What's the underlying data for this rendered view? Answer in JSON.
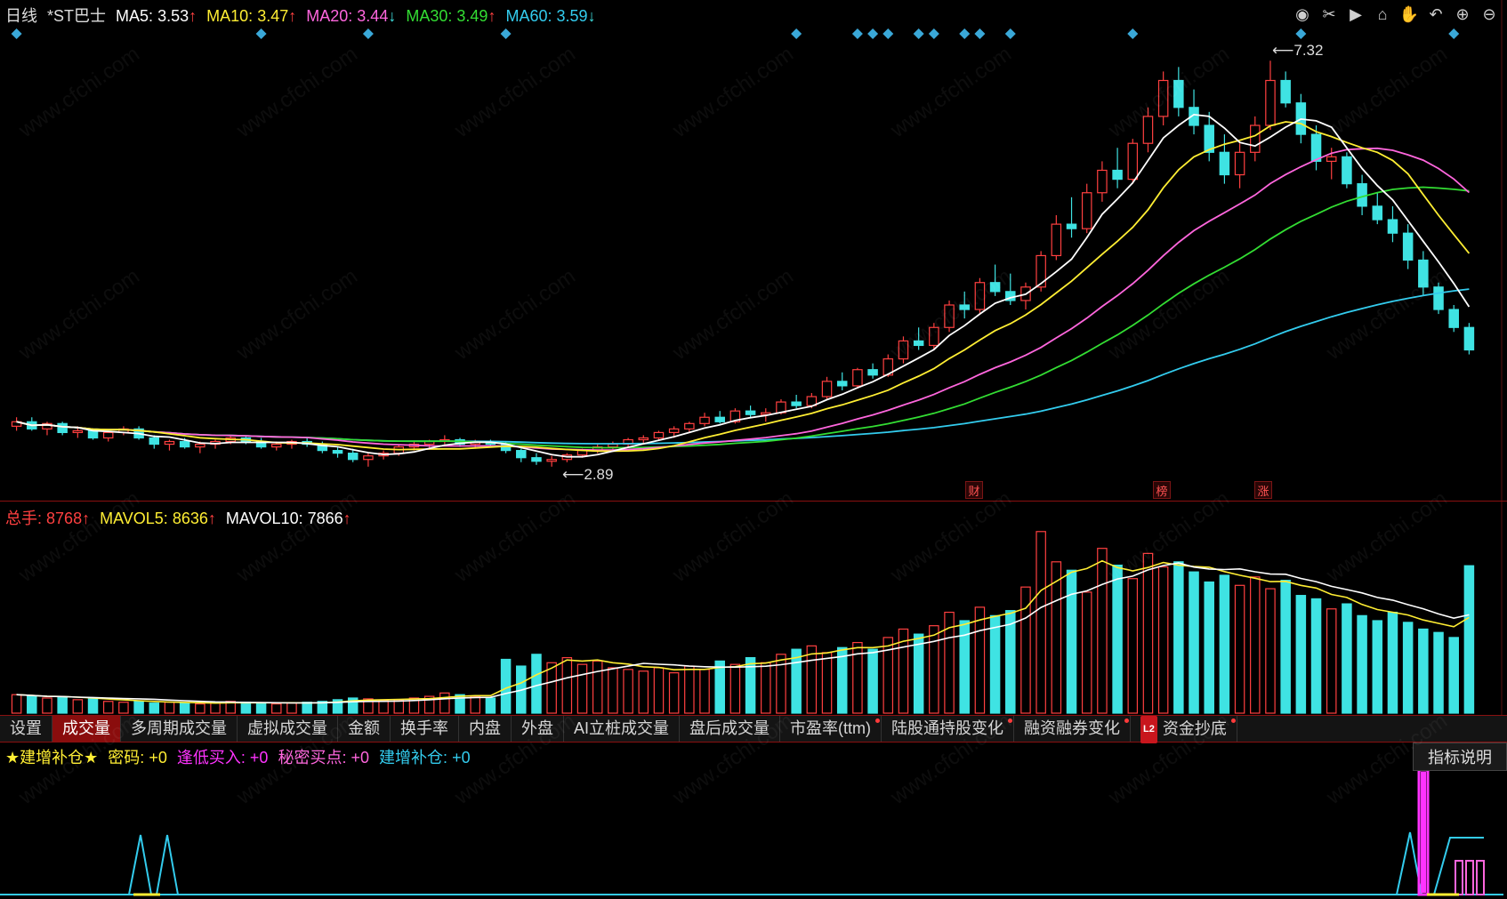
{
  "main_info": {
    "period": "日线",
    "stock": "*ST巴士",
    "ma5_label": "MA5:",
    "ma5": "3.53",
    "ma5_arrow": "↑",
    "ma10_label": "MA10:",
    "ma10": "3.47",
    "ma10_arrow": "↑",
    "ma20_label": "MA20:",
    "ma20": "3.44",
    "ma20_arrow": "↓",
    "ma30_label": "MA30:",
    "ma30": "3.49",
    "ma30_arrow": "↑",
    "ma60_label": "MA60:",
    "ma60": "3.59",
    "ma60_arrow": "↓"
  },
  "toolbar": [
    "eye-icon",
    "scissors-icon",
    "play-icon",
    "lock-icon",
    "hand-icon",
    "undo-icon",
    "zoom-in-icon",
    "zoom-out-icon"
  ],
  "toolbar_glyphs": [
    "◉",
    "✂",
    "▶",
    "⌂",
    "✋",
    "↶",
    "⊕",
    "⊖"
  ],
  "markers": {
    "cai": "财",
    "bang": "榜",
    "zhang": "涨"
  },
  "price_high": "7.32",
  "price_low": "2.89",
  "volume_info": {
    "total_label": "总手:",
    "total": "8768",
    "total_arrow": "↑",
    "mavol5_label": "MAVOL5:",
    "mavol5": "8636",
    "mavol5_arrow": "↑",
    "mavol10_label": "MAVOL10:",
    "mavol10": "7866",
    "mavol10_arrow": "↑"
  },
  "tabs": [
    {
      "label": "设置",
      "dot": false
    },
    {
      "label": "成交量",
      "dot": false,
      "active": true
    },
    {
      "label": "多周期成交量",
      "dot": false
    },
    {
      "label": "虚拟成交量",
      "dot": false
    },
    {
      "label": "金额",
      "dot": false
    },
    {
      "label": "换手率",
      "dot": false
    },
    {
      "label": "内盘",
      "dot": false
    },
    {
      "label": "外盘",
      "dot": false
    },
    {
      "label": "AI立桩成交量",
      "dot": false
    },
    {
      "label": "盘后成交量",
      "dot": false
    },
    {
      "label": "市盈率(ttm)",
      "dot": true
    },
    {
      "label": "陆股通持股变化",
      "dot": true
    },
    {
      "label": "融资融券变化",
      "dot": true
    },
    {
      "label": "资金抄底",
      "dot": true,
      "badge": "L2"
    }
  ],
  "indicator_info": {
    "title": "★建增补仓★",
    "mima_label": "密码:",
    "mima": "+0",
    "fengdi_label": "逢低买入:",
    "fengdi": "+0",
    "mimi_label": "秘密买点:",
    "mimi": "+0",
    "jianzeng_label": "建增补仓:",
    "jianzeng": "+0"
  },
  "explain_button": "指标说明",
  "watermark": "www.cfchi.com",
  "colors": {
    "up": "#ff4040",
    "down": "#3fe3e3",
    "ma5": "#ffffff",
    "ma10": "#ffee33",
    "ma20": "#ff66dd",
    "ma30": "#33dd33",
    "ma60": "#33ccee"
  },
  "chart_data": {
    "type": "candlestick",
    "ohlc": [
      [
        3.25,
        3.35,
        3.2,
        3.3
      ],
      [
        3.3,
        3.35,
        3.2,
        3.22
      ],
      [
        3.22,
        3.3,
        3.15,
        3.28
      ],
      [
        3.28,
        3.3,
        3.15,
        3.18
      ],
      [
        3.18,
        3.25,
        3.12,
        3.2
      ],
      [
        3.2,
        3.22,
        3.1,
        3.12
      ],
      [
        3.12,
        3.2,
        3.08,
        3.18
      ],
      [
        3.18,
        3.25,
        3.15,
        3.22
      ],
      [
        3.22,
        3.25,
        3.1,
        3.12
      ],
      [
        3.12,
        3.15,
        3.0,
        3.05
      ],
      [
        3.05,
        3.1,
        2.98,
        3.08
      ],
      [
        3.08,
        3.12,
        3.0,
        3.02
      ],
      [
        3.02,
        3.08,
        2.95,
        3.05
      ],
      [
        3.05,
        3.1,
        3.0,
        3.08
      ],
      [
        3.08,
        3.15,
        3.05,
        3.12
      ],
      [
        3.12,
        3.15,
        3.05,
        3.08
      ],
      [
        3.08,
        3.12,
        3.0,
        3.02
      ],
      [
        3.02,
        3.08,
        2.98,
        3.05
      ],
      [
        3.05,
        3.1,
        3.0,
        3.08
      ],
      [
        3.08,
        3.12,
        3.02,
        3.05
      ],
      [
        3.05,
        3.08,
        2.95,
        2.98
      ],
      [
        2.98,
        3.02,
        2.9,
        2.95
      ],
      [
        2.95,
        3.0,
        2.85,
        2.88
      ],
      [
        2.88,
        2.95,
        2.8,
        2.92
      ],
      [
        2.92,
        2.98,
        2.88,
        2.95
      ],
      [
        2.95,
        3.05,
        2.92,
        3.02
      ],
      [
        3.02,
        3.08,
        2.98,
        3.05
      ],
      [
        3.05,
        3.1,
        3.0,
        3.08
      ],
      [
        3.08,
        3.15,
        3.05,
        3.1
      ],
      [
        3.1,
        3.12,
        3.02,
        3.05
      ],
      [
        3.05,
        3.1,
        3.0,
        3.08
      ],
      [
        3.08,
        3.1,
        3.02,
        3.05
      ],
      [
        3.05,
        3.08,
        2.95,
        2.98
      ],
      [
        2.98,
        3.0,
        2.85,
        2.9
      ],
      [
        2.9,
        2.95,
        2.82,
        2.86
      ],
      [
        2.86,
        2.92,
        2.8,
        2.88
      ],
      [
        2.88,
        2.95,
        2.85,
        2.93
      ],
      [
        2.93,
        3.0,
        2.9,
        2.98
      ],
      [
        2.98,
        3.05,
        2.95,
        3.02
      ],
      [
        3.02,
        3.08,
        2.98,
        3.05
      ],
      [
        3.05,
        3.12,
        3.02,
        3.1
      ],
      [
        3.1,
        3.15,
        3.05,
        3.12
      ],
      [
        3.12,
        3.2,
        3.1,
        3.18
      ],
      [
        3.18,
        3.25,
        3.12,
        3.22
      ],
      [
        3.22,
        3.3,
        3.18,
        3.28
      ],
      [
        3.28,
        3.4,
        3.25,
        3.35
      ],
      [
        3.35,
        3.42,
        3.28,
        3.3
      ],
      [
        3.3,
        3.45,
        3.28,
        3.42
      ],
      [
        3.42,
        3.48,
        3.35,
        3.38
      ],
      [
        3.38,
        3.45,
        3.3,
        3.4
      ],
      [
        3.4,
        3.55,
        3.38,
        3.52
      ],
      [
        3.52,
        3.6,
        3.45,
        3.48
      ],
      [
        3.48,
        3.62,
        3.45,
        3.58
      ],
      [
        3.58,
        3.8,
        3.55,
        3.75
      ],
      [
        3.75,
        3.85,
        3.65,
        3.7
      ],
      [
        3.7,
        3.9,
        3.68,
        3.88
      ],
      [
        3.88,
        3.95,
        3.78,
        3.82
      ],
      [
        3.82,
        4.05,
        3.8,
        4.0
      ],
      [
        4.0,
        4.25,
        3.95,
        4.2
      ],
      [
        4.2,
        4.35,
        4.1,
        4.15
      ],
      [
        4.15,
        4.4,
        4.1,
        4.35
      ],
      [
        4.35,
        4.65,
        4.3,
        4.6
      ],
      [
        4.6,
        4.75,
        4.45,
        4.55
      ],
      [
        4.55,
        4.9,
        4.5,
        4.85
      ],
      [
        4.85,
        5.05,
        4.7,
        4.75
      ],
      [
        4.75,
        4.95,
        4.6,
        4.65
      ],
      [
        4.65,
        4.85,
        4.55,
        4.8
      ],
      [
        4.8,
        5.2,
        4.75,
        5.15
      ],
      [
        5.15,
        5.6,
        5.1,
        5.5
      ],
      [
        5.5,
        5.8,
        5.35,
        5.45
      ],
      [
        5.45,
        5.95,
        5.4,
        5.85
      ],
      [
        5.85,
        6.2,
        5.75,
        6.1
      ],
      [
        6.1,
        6.35,
        5.9,
        6.0
      ],
      [
        6.0,
        6.45,
        5.95,
        6.4
      ],
      [
        6.4,
        6.8,
        6.3,
        6.7
      ],
      [
        6.7,
        7.2,
        6.6,
        7.1
      ],
      [
        7.1,
        7.25,
        6.7,
        6.8
      ],
      [
        6.8,
        7.0,
        6.5,
        6.6
      ],
      [
        6.6,
        6.75,
        6.2,
        6.3
      ],
      [
        6.3,
        6.5,
        5.95,
        6.05
      ],
      [
        6.05,
        6.4,
        5.9,
        6.3
      ],
      [
        6.3,
        6.7,
        6.2,
        6.6
      ],
      [
        6.6,
        7.32,
        6.55,
        7.1
      ],
      [
        7.1,
        7.2,
        6.8,
        6.85
      ],
      [
        6.85,
        6.95,
        6.4,
        6.5
      ],
      [
        6.5,
        6.6,
        6.1,
        6.2
      ],
      [
        6.2,
        6.35,
        6.0,
        6.25
      ],
      [
        6.25,
        6.3,
        5.9,
        5.95
      ],
      [
        5.95,
        6.05,
        5.6,
        5.7
      ],
      [
        5.7,
        5.85,
        5.5,
        5.55
      ],
      [
        5.55,
        5.7,
        5.3,
        5.4
      ],
      [
        5.4,
        5.5,
        5.0,
        5.1
      ],
      [
        5.1,
        5.2,
        4.7,
        4.8
      ],
      [
        4.8,
        4.85,
        4.5,
        4.55
      ],
      [
        4.55,
        4.6,
        4.3,
        4.35
      ],
      [
        4.35,
        4.4,
        4.05,
        4.1
      ]
    ],
    "volume": [
      1100,
      1000,
      900,
      950,
      800,
      850,
      700,
      650,
      700,
      600,
      650,
      600,
      550,
      600,
      700,
      650,
      600,
      550,
      600,
      650,
      700,
      800,
      900,
      850,
      750,
      800,
      900,
      1000,
      1200,
      1100,
      1000,
      900,
      3200,
      2800,
      3500,
      3000,
      3300,
      2900,
      3100,
      2700,
      2600,
      2500,
      2700,
      2400,
      2800,
      2600,
      3100,
      2900,
      3300,
      3000,
      3500,
      3800,
      4000,
      3600,
      3900,
      4200,
      3800,
      4500,
      5000,
      4700,
      5200,
      6000,
      5500,
      6300,
      5800,
      6100,
      7500,
      10800,
      9000,
      8500,
      7200,
      9800,
      8800,
      8000,
      9500,
      8700,
      9000,
      8400,
      7800,
      8200,
      7600,
      8100,
      7400,
      7900,
      7000,
      6800,
      6200,
      6500,
      5800,
      5500,
      6000,
      5400,
      5000,
      4800,
      4500,
      8768
    ],
    "price_range": [
      2.6,
      7.6
    ],
    "volume_max": 11000
  }
}
